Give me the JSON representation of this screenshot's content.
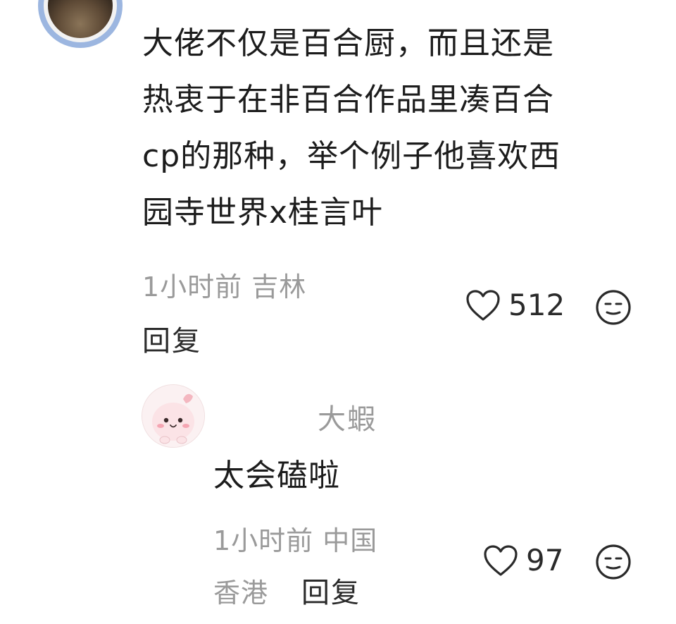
{
  "comment": {
    "lines": [
      "大佬不仅是百合厨，而且还是",
      "热衷于在非百合作品里凑百合",
      "cp的那种，举个例子他喜欢西",
      "园寺世界x桂言叶"
    ],
    "time_location": "1小时前 吉林",
    "reply_label": "回复",
    "like_count": "512"
  },
  "reply": {
    "username": "大蝦",
    "text": "太会磕啦",
    "time_location_line1": "1小时前 中国",
    "time_location_line2": "香港",
    "reply_label": "回复",
    "like_count": "97"
  },
  "icons": {
    "like": "heart-outline-icon",
    "dislike": "unamused-face-icon"
  }
}
